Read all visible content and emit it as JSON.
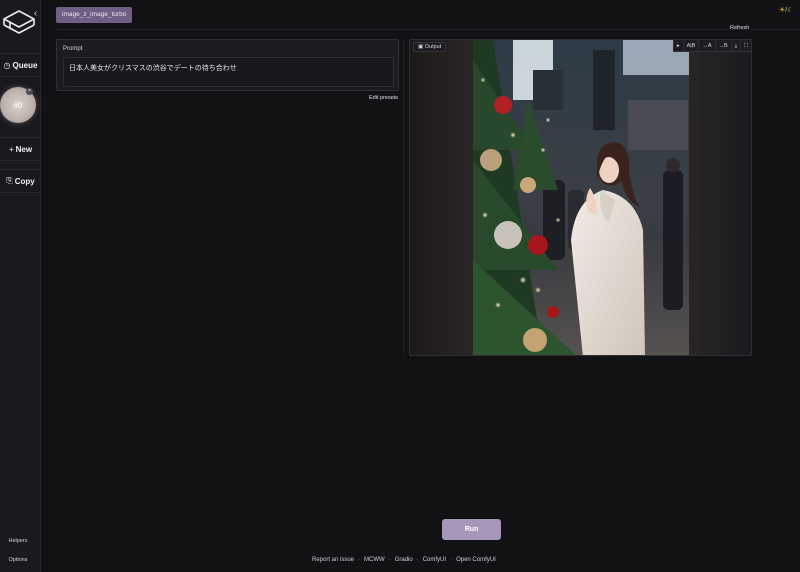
{
  "sidebar": {
    "queue_label": "Queue",
    "new_label": "New",
    "copy_label": "Copy",
    "job_badge": "#0",
    "remove_glyph": "×",
    "collapse_glyph": "‹",
    "helpers_label": "Helpers",
    "options_label": "Options"
  },
  "header": {
    "model_name": "image_z_image_turbo",
    "refresh_label": "Refresh",
    "theme_toggle": {
      "sun": "☀",
      "sep": "/",
      "moon": "☾"
    }
  },
  "prompt": {
    "label": "Prompt",
    "value": "日本人美女がクリスマスの渋谷でデートの待ち合わせ",
    "edit_presets_label": "Edit presets"
  },
  "output": {
    "label": "Output",
    "tools": [
      "A|B",
      "→A",
      "→B"
    ]
  },
  "run_label": "Run",
  "footer": {
    "links": [
      "Report an issue",
      "MCWW",
      "Gradio",
      "ComfyUI",
      "Open ComfyUI"
    ],
    "separator": "·"
  },
  "colors": {
    "accent": "#6f5f86",
    "run_button": "#a497ba",
    "background": "#121114"
  }
}
